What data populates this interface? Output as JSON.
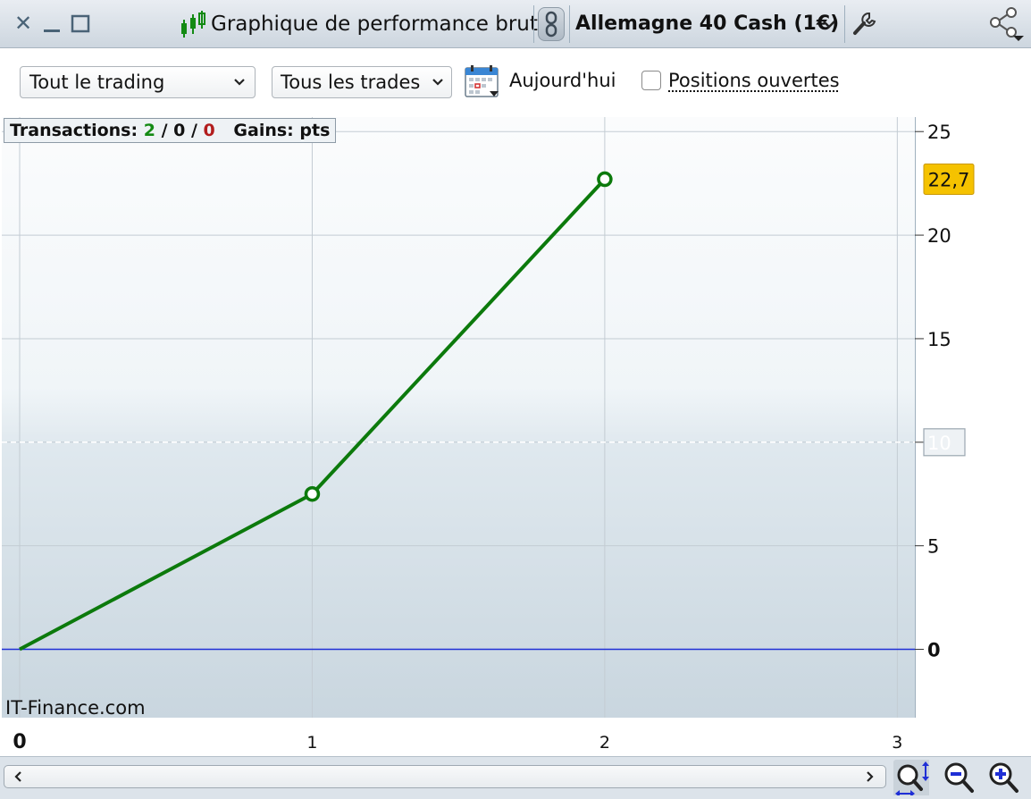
{
  "window": {
    "title": "Graphique de performance brute",
    "instrument": "Allemagne 40 Cash (1€)"
  },
  "controls": {
    "scope_select": "Tout le trading",
    "trades_select": "Tous les trades",
    "date_label": "Aujourd'hui",
    "open_positions_label": "Positions ouvertes",
    "open_positions_checked": false
  },
  "summary": {
    "transactions_label": "Transactions:",
    "winning": "2",
    "neutral": "0",
    "losing": "0",
    "gains_label": "Gains:",
    "gains_unit": "pts"
  },
  "watermark": "IT-Finance.com",
  "colors": {
    "series": "#0c7a0c",
    "zero_line": "#1f2fd6",
    "last_value_bg": "#f5c200",
    "winning": "#138a13",
    "losing": "#b21d1d"
  },
  "chart_data": {
    "type": "line",
    "x": [
      0,
      1,
      2
    ],
    "y": [
      0,
      7.5,
      22.7
    ],
    "xlim": [
      0,
      3.06
    ],
    "ylim": [
      -3.3,
      25.7
    ],
    "x_ticks": [
      0,
      1,
      2,
      3
    ],
    "y_ticks": [
      0,
      5,
      10,
      15,
      20,
      25
    ],
    "last_value_label": "22,7",
    "reference_line": 10,
    "grid": true,
    "y_axis_side": "right"
  },
  "icons": {
    "close": "close-icon",
    "minimize": "minimize-icon",
    "maximize": "maximize-icon",
    "chart": "candlestick-icon",
    "link": "link-icon",
    "settings": "wrench-icon",
    "share": "share-icon",
    "calendar": "calendar-icon",
    "zoom_auto": "zoom-vertical-icon",
    "zoom_out": "zoom-out-icon",
    "zoom_in": "zoom-in-icon"
  }
}
